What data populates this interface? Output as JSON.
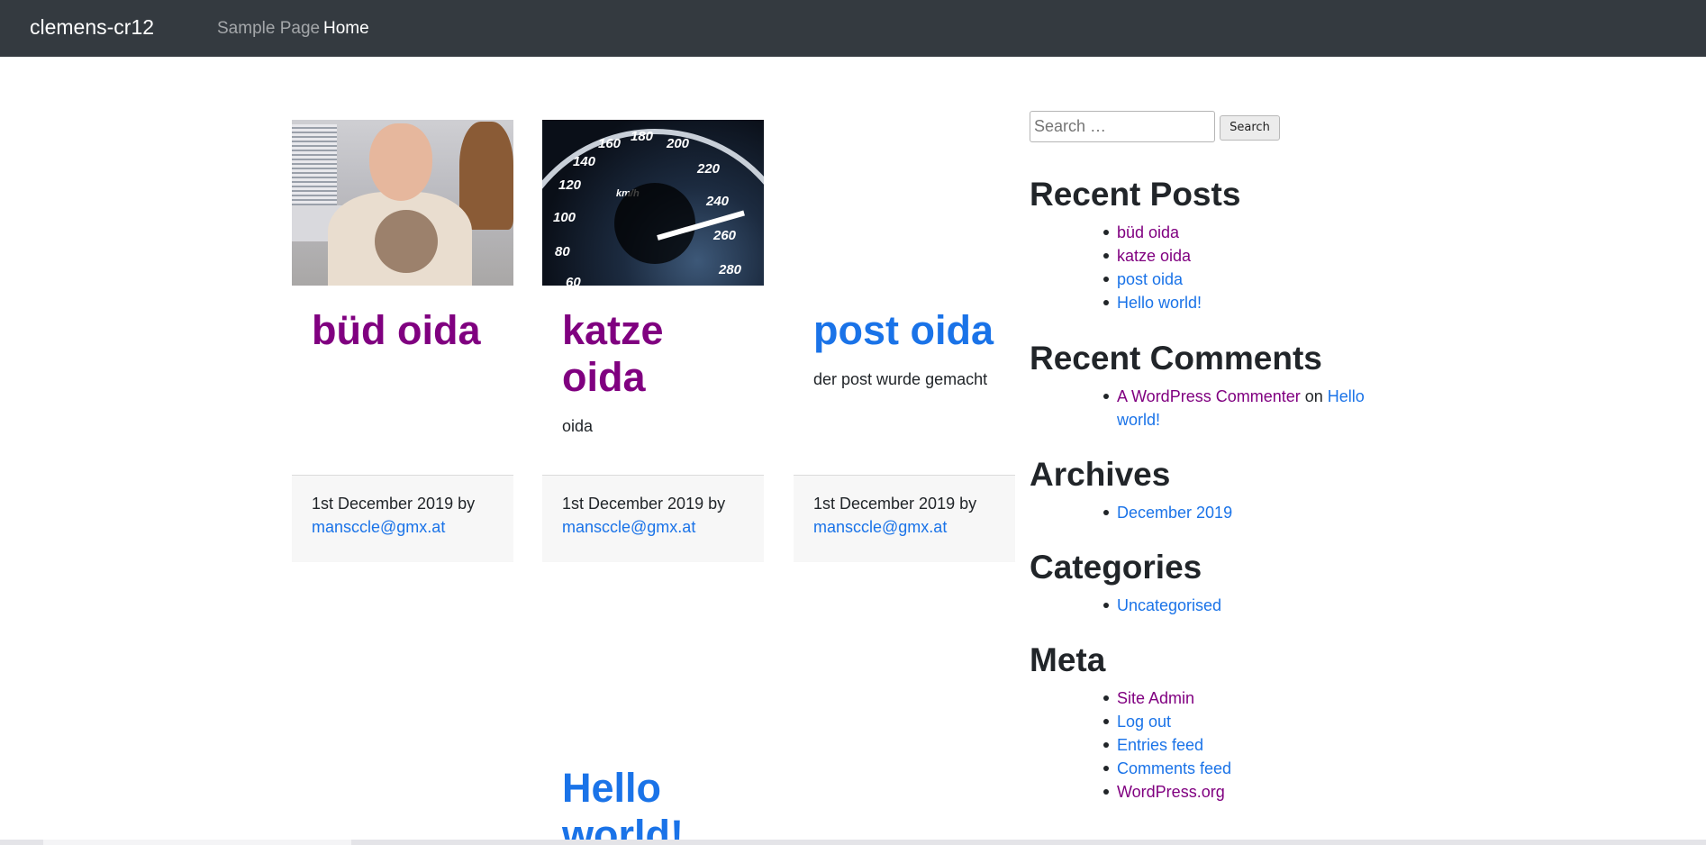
{
  "navbar": {
    "brand": "clemens-cr12",
    "links": [
      {
        "label": "Sample Page"
      },
      {
        "label": "Home"
      }
    ]
  },
  "posts": [
    {
      "title": "büd oida",
      "excerpt": "",
      "date_by": "1st December 2019 by",
      "author": "mansccle@gmx.at"
    },
    {
      "title": "katze oida",
      "excerpt": "oida",
      "date_by": "1st December 2019 by",
      "author": "mansccle@gmx.at"
    },
    {
      "title": "post oida",
      "excerpt": "der post wurde gemacht",
      "date_by": "1st December 2019 by",
      "author": "mansccle@gmx.at"
    },
    {
      "title": "Hello world!"
    }
  ],
  "speedometer": {
    "ticks": [
      "60",
      "80",
      "100",
      "120",
      "140",
      "160",
      "180",
      "200",
      "220",
      "240",
      "260",
      "280"
    ],
    "unit": "km/h"
  },
  "sidebar": {
    "search": {
      "placeholder": "Search …",
      "button": "Search"
    },
    "recent_posts": {
      "title": "Recent Posts",
      "items": [
        "büd oida",
        "katze oida",
        "post oida",
        "Hello world!"
      ]
    },
    "recent_comments": {
      "title": "Recent Comments",
      "commenter": "A WordPress Commenter",
      "on": "on",
      "post_line1": "Hello",
      "post_line2": "world!"
    },
    "archives": {
      "title": "Archives",
      "items": [
        "December 2019"
      ]
    },
    "categories": {
      "title": "Categories",
      "items": [
        "Uncategorised"
      ]
    },
    "meta": {
      "title": "Meta",
      "items": [
        "Site Admin",
        "Log out",
        "Entries feed",
        "Comments feed",
        "WordPress.org"
      ]
    }
  },
  "colors": {
    "navbar": "#343a40",
    "link": "#1a73e8",
    "visited": "#800080",
    "footer_bg": "#f7f7f7"
  }
}
